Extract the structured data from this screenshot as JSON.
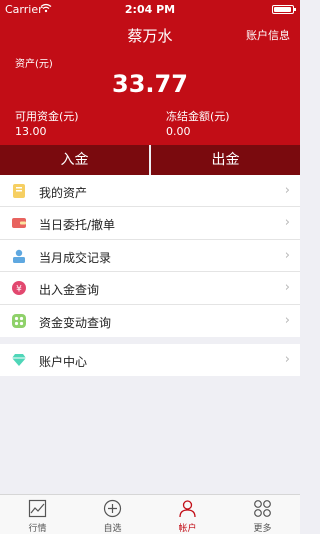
{
  "status_bar": {
    "carrier": "Carrier",
    "time": "2:04 PM"
  },
  "header": {
    "title": "蔡万水",
    "account_info": "账户信息",
    "asset_label": "资产(元)",
    "asset_value": "33.77",
    "available_label": "可用资金(元)",
    "available_value": "13.00",
    "frozen_label": "冻结金额(元)",
    "frozen_value": "0.00"
  },
  "fund_actions": {
    "deposit": "入金",
    "withdraw": "出金"
  },
  "menu": [
    {
      "label": "我的资产",
      "icon": "folder-icon"
    },
    {
      "label": "当日委托/撤单",
      "icon": "wallet-icon"
    },
    {
      "label": "当月成交记录",
      "icon": "user-card-icon"
    },
    {
      "label": "出入金查询",
      "icon": "money-bag-icon"
    },
    {
      "label": "资金变动查询",
      "icon": "dots-icon"
    }
  ],
  "account_center": {
    "label": "账户中心",
    "icon": "diamond-icon"
  },
  "tabbar": [
    {
      "label": "行情",
      "icon": "chart-icon",
      "active": false
    },
    {
      "label": "自选",
      "icon": "plus-circle-icon",
      "active": false
    },
    {
      "label": "帐户",
      "icon": "person-icon",
      "active": true
    },
    {
      "label": "更多",
      "icon": "grid-icon",
      "active": false
    }
  ],
  "colors": {
    "brand_red": "#c20d16",
    "dark_red": "#7a0a0e",
    "background": "#efeff4"
  }
}
